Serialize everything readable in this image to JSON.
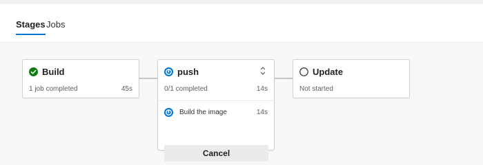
{
  "tabs": [
    {
      "label": "Stages",
      "active": true
    },
    {
      "label": "Jobs",
      "active": false
    }
  ],
  "stages": [
    {
      "name": "Build",
      "status": "succeeded",
      "status_icon": "check-circle-icon",
      "summary": "1 job completed",
      "duration": "45s"
    },
    {
      "name": "push",
      "status": "running",
      "status_icon": "running-icon",
      "summary": "0/1 completed",
      "duration": "14s",
      "expanded": true,
      "jobs": [
        {
          "name": "Build the image",
          "status_icon": "running-icon",
          "duration": "14s"
        }
      ],
      "cancel_label": "Cancel"
    },
    {
      "name": "Update",
      "status": "not-started",
      "status_icon": "empty-circle-icon",
      "summary": "Not started"
    }
  ],
  "colors": {
    "success": "#107c10",
    "running": "#0078d4",
    "pending": "#605e5c",
    "accent": "#0078d4"
  }
}
